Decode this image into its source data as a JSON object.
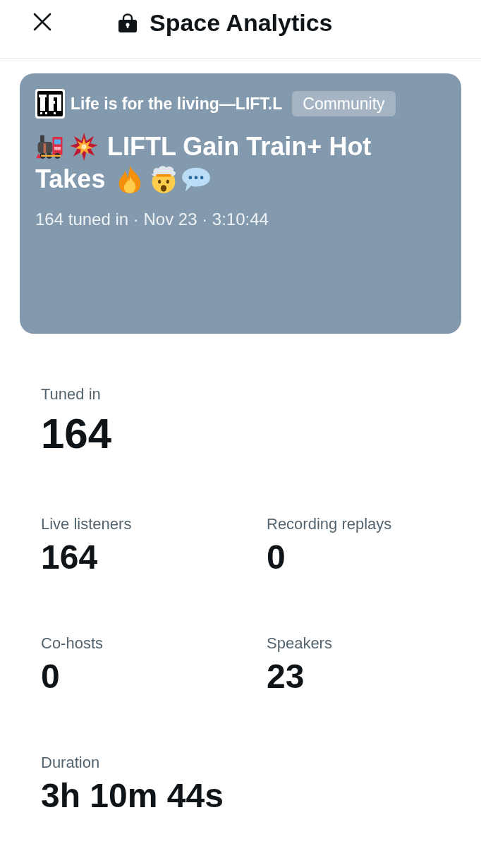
{
  "header": {
    "title": "Space Analytics"
  },
  "space_card": {
    "community": {
      "name": "Life is for the living—LIFT.L",
      "badge": "Community"
    },
    "title_lines": [
      "LIFTL Gain Train+ Hot",
      "Takes"
    ],
    "meta": "164 tuned in · Nov 23 · 3:10:44"
  },
  "stats": [
    {
      "kind": "large",
      "label": "Tuned in",
      "value": "164"
    },
    {
      "kind": "regular",
      "label": "Live listeners",
      "value": "164"
    },
    {
      "kind": "regular",
      "label": "Recording replays",
      "value": "0"
    },
    {
      "kind": "regular",
      "label": "Co-hosts",
      "value": "0"
    },
    {
      "kind": "regular",
      "label": "Speakers",
      "value": "23"
    },
    {
      "kind": "regular",
      "label": "Duration",
      "value": "3h 10m 44s"
    }
  ]
}
